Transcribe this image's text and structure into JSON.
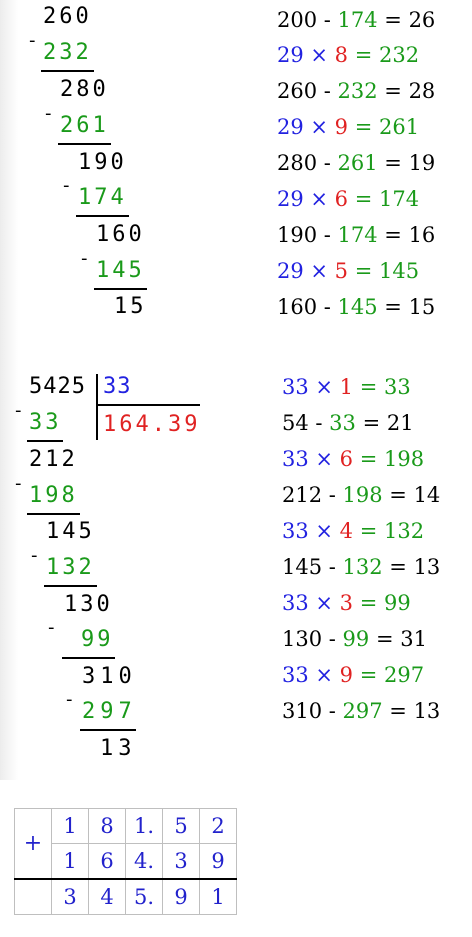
{
  "division1": {
    "steps": [
      {
        "d": "260",
        "s": "232"
      },
      {
        "d": "280",
        "s": "261"
      },
      {
        "d": "190",
        "s": "174"
      },
      {
        "d": "160",
        "s": "145"
      }
    ],
    "remainder": "15",
    "equations": [
      [
        {
          "t": "200 - ",
          "c": "black"
        },
        {
          "t": "174",
          "c": "green"
        },
        {
          "t": " = 26",
          "c": "black"
        }
      ],
      [
        {
          "t": "29 × ",
          "c": "blue"
        },
        {
          "t": "8",
          "c": "red"
        },
        {
          "t": " = 232",
          "c": "green"
        }
      ],
      [
        {
          "t": "260 - ",
          "c": "black"
        },
        {
          "t": "232",
          "c": "green"
        },
        {
          "t": " = 28",
          "c": "black"
        }
      ],
      [
        {
          "t": "29 × ",
          "c": "blue"
        },
        {
          "t": "9",
          "c": "red"
        },
        {
          "t": " = 261",
          "c": "green"
        }
      ],
      [
        {
          "t": "280 - ",
          "c": "black"
        },
        {
          "t": "261",
          "c": "green"
        },
        {
          "t": " = 19",
          "c": "black"
        }
      ],
      [
        {
          "t": "29 × ",
          "c": "blue"
        },
        {
          "t": "6",
          "c": "red"
        },
        {
          "t": " = 174",
          "c": "green"
        }
      ],
      [
        {
          "t": "190 - ",
          "c": "black"
        },
        {
          "t": "174",
          "c": "green"
        },
        {
          "t": " = 16",
          "c": "black"
        }
      ],
      [
        {
          "t": "29 × ",
          "c": "blue"
        },
        {
          "t": "5",
          "c": "red"
        },
        {
          "t": " = 145",
          "c": "green"
        }
      ],
      [
        {
          "t": "160 - ",
          "c": "black"
        },
        {
          "t": "145",
          "c": "green"
        },
        {
          "t": " = 15",
          "c": "black"
        }
      ]
    ]
  },
  "division2": {
    "dividend": "5425",
    "divisor": "33",
    "quotient": "164.39",
    "steps": [
      {
        "d": "",
        "s": "33"
      },
      {
        "d": "212",
        "s": "198"
      },
      {
        "d": "145",
        "s": "132"
      },
      {
        "d": "130",
        "s": "99"
      },
      {
        "d": "310",
        "s": "297"
      }
    ],
    "remainder": "13",
    "equations": [
      [
        {
          "t": "33 × ",
          "c": "blue"
        },
        {
          "t": "1",
          "c": "red"
        },
        {
          "t": " = 33",
          "c": "green"
        }
      ],
      [
        {
          "t": "54 - ",
          "c": "black"
        },
        {
          "t": "33",
          "c": "green"
        },
        {
          "t": " = 21",
          "c": "black"
        }
      ],
      [
        {
          "t": "33 × ",
          "c": "blue"
        },
        {
          "t": "6",
          "c": "red"
        },
        {
          "t": " = 198",
          "c": "green"
        }
      ],
      [
        {
          "t": "212 - ",
          "c": "black"
        },
        {
          "t": "198",
          "c": "green"
        },
        {
          "t": " = 14",
          "c": "black"
        }
      ],
      [
        {
          "t": "33 × ",
          "c": "blue"
        },
        {
          "t": "4",
          "c": "red"
        },
        {
          "t": " = 132",
          "c": "green"
        }
      ],
      [
        {
          "t": "145 - ",
          "c": "black"
        },
        {
          "t": "132",
          "c": "green"
        },
        {
          "t": " = 13",
          "c": "black"
        }
      ],
      [
        {
          "t": "33 × ",
          "c": "blue"
        },
        {
          "t": "3",
          "c": "red"
        },
        {
          "t": " = 99",
          "c": "green"
        }
      ],
      [
        {
          "t": "130 - ",
          "c": "black"
        },
        {
          "t": "99",
          "c": "green"
        },
        {
          "t": " = 31",
          "c": "black"
        }
      ],
      [
        {
          "t": "33 × ",
          "c": "blue"
        },
        {
          "t": "9",
          "c": "red"
        },
        {
          "t": " = 297",
          "c": "green"
        }
      ],
      [
        {
          "t": "310 - ",
          "c": "black"
        },
        {
          "t": "297",
          "c": "green"
        },
        {
          "t": " = 13",
          "c": "black"
        }
      ]
    ]
  },
  "addition": {
    "operator": "+",
    "rows": [
      [
        "1",
        "8",
        "1.",
        "5",
        "2"
      ],
      [
        "1",
        "6",
        "4.",
        "3",
        "9"
      ]
    ],
    "result": [
      "3",
      "4",
      "5.",
      "9",
      "1"
    ]
  },
  "colors": {
    "black": "#000000",
    "green": "#1a9a1a",
    "blue": "#2222e0",
    "red": "#e02222"
  }
}
